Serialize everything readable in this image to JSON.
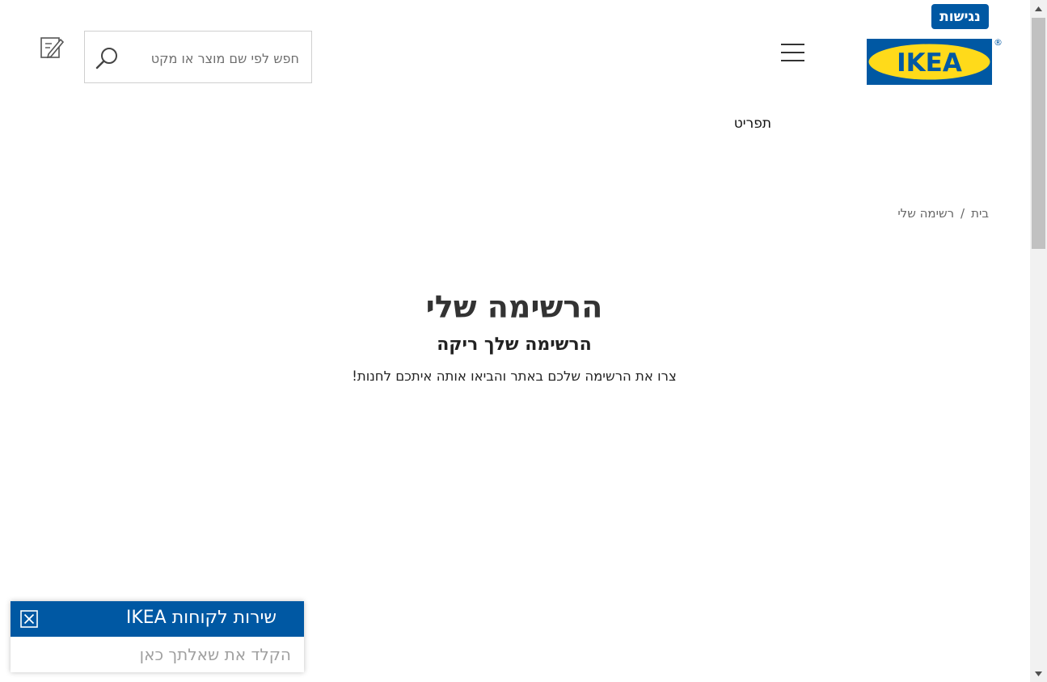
{
  "header": {
    "accessibility_label": "נגישות",
    "logo_text": "IKEA",
    "logo_mark": "®",
    "search_placeholder": "חפש לפי שם מוצר או מקט",
    "menu_label": "תפריט"
  },
  "breadcrumb": {
    "home": "בית",
    "separator": "/",
    "current": "רשימה שלי"
  },
  "main": {
    "title": "הרשימה שלי",
    "subtitle": "הרשימה שלך ריקה",
    "description": "צרו את הרשימה שלכם באתר והביאו אותה איתכם לחנות!"
  },
  "chat": {
    "title": "שירות לקוחות IKEA",
    "input_placeholder": "הקלד את שאלתך כאן"
  },
  "colors": {
    "ikea_blue": "#0058a3",
    "ikea_yellow": "#ffda1a"
  },
  "icons": [
    "hamburger-menu-icon",
    "search-icon",
    "shopping-list-icon",
    "close-icon",
    "scroll-up-icon",
    "scroll-down-icon"
  ]
}
